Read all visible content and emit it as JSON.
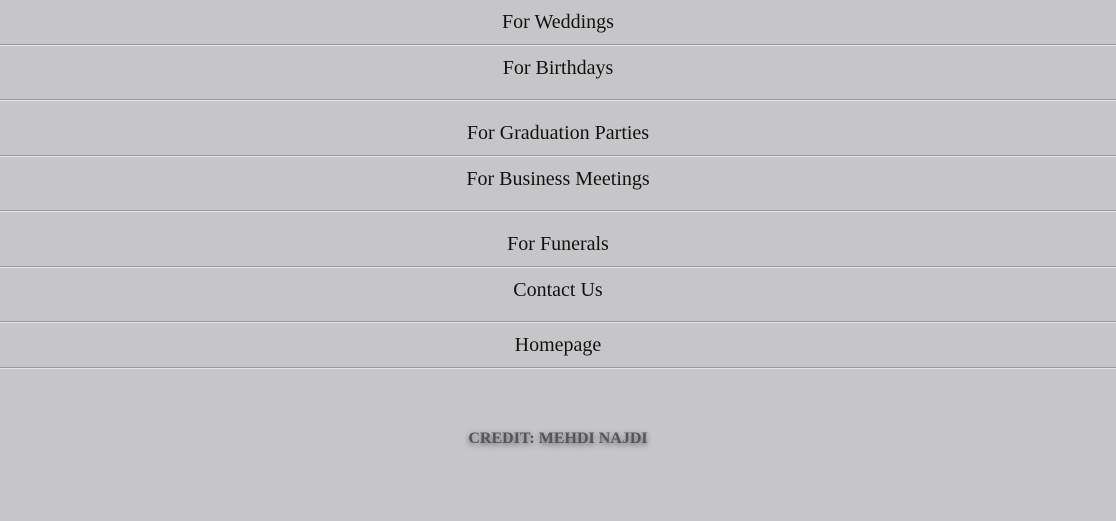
{
  "nav": {
    "items": [
      {
        "label": "For Weddings"
      },
      {
        "label": "For Birthdays"
      },
      {
        "label": "For Graduation Parties"
      },
      {
        "label": "For Business Meetings"
      },
      {
        "label": "For Funerals"
      },
      {
        "label": "Contact Us"
      },
      {
        "label": "Homepage"
      }
    ]
  },
  "footer": {
    "credit": "CREDIT: MEHDI NAJDI"
  },
  "colors": {
    "background": "#c6c6c8",
    "text": "#111111",
    "credit_text": "#555557"
  }
}
